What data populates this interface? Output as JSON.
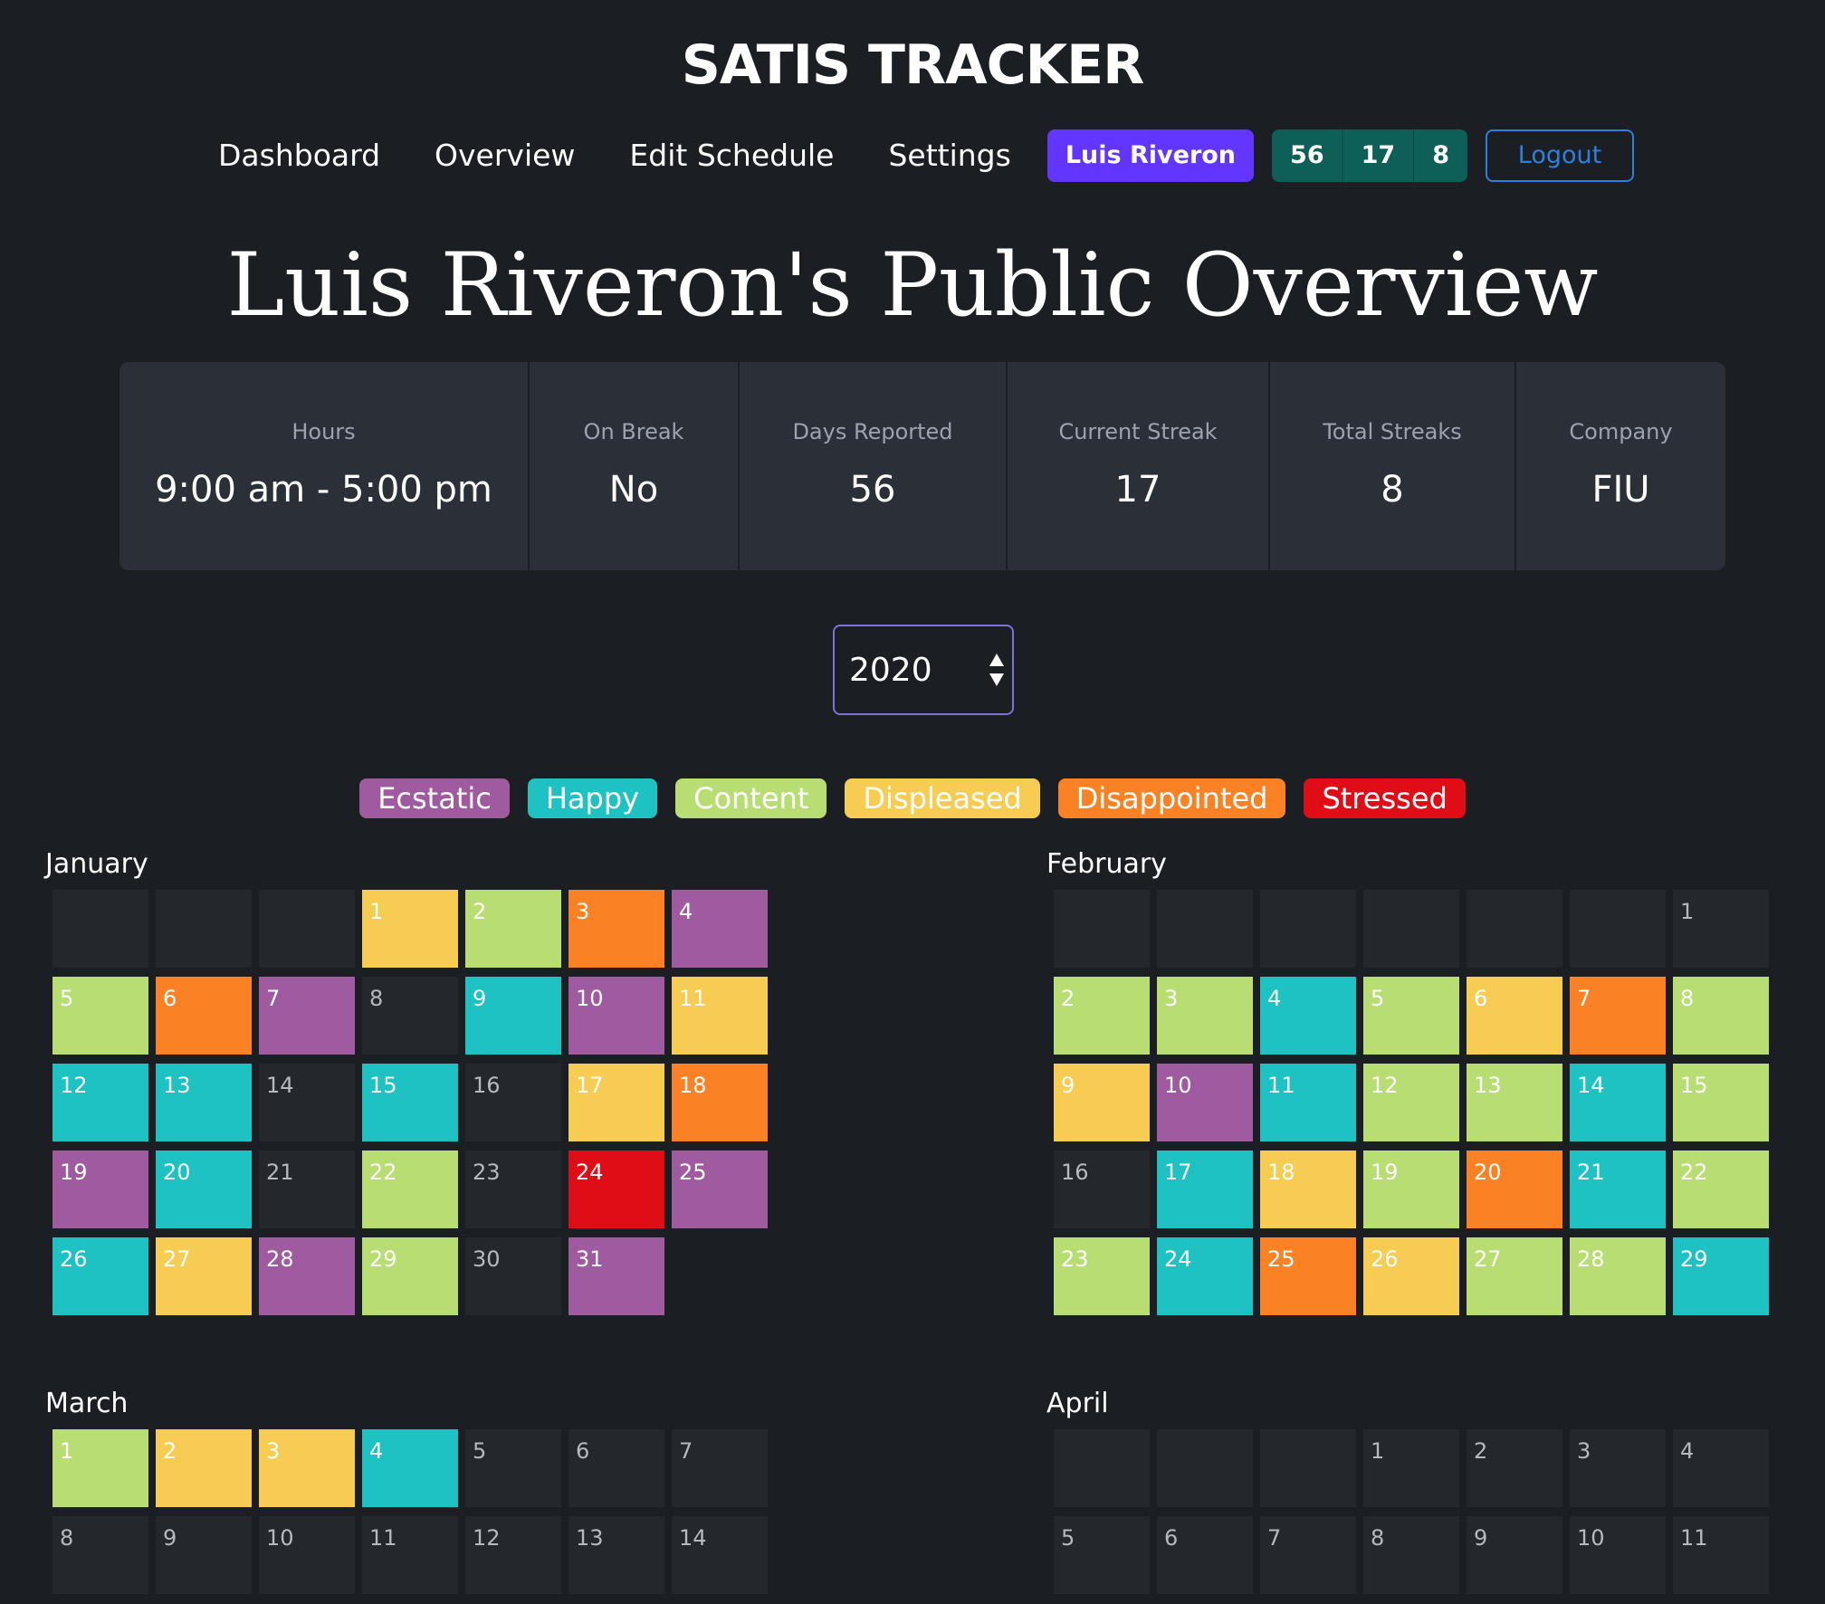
{
  "header": {
    "brand": "SATIS TRACKER"
  },
  "nav": {
    "links": [
      "Dashboard",
      "Overview",
      "Edit Schedule",
      "Settings"
    ],
    "user": "Luis Riveron",
    "counters": [
      "56",
      "17",
      "8"
    ],
    "logout": "Logout"
  },
  "page": {
    "title": "Luis Riveron's Public Overview"
  },
  "stats": [
    {
      "label": "Hours",
      "value": "9:00 am - 5:00 pm"
    },
    {
      "label": "On Break",
      "value": "No"
    },
    {
      "label": "Days Reported",
      "value": "56"
    },
    {
      "label": "Current Streak",
      "value": "17"
    },
    {
      "label": "Total Streaks",
      "value": "8"
    },
    {
      "label": "Company",
      "value": "FIU"
    }
  ],
  "year_select": {
    "value": "2020"
  },
  "moods": {
    "ecstatic": {
      "label": "Ecstatic",
      "color": "#a05a9f"
    },
    "happy": {
      "label": "Happy",
      "color": "#1fc2c2"
    },
    "content": {
      "label": "Content",
      "color": "#b8dd73"
    },
    "displeased": {
      "label": "Displeased",
      "color": "#f6cc52"
    },
    "disappointed": {
      "label": "Disappointed",
      "color": "#fb8224"
    },
    "stressed": {
      "label": "Stressed",
      "color": "#e00d17"
    }
  },
  "legend": [
    "ecstatic",
    "happy",
    "content",
    "displeased",
    "disappointed",
    "stressed"
  ],
  "months": [
    {
      "name": "January",
      "offset": 3,
      "days": 31,
      "moods": [
        "displeased",
        "content",
        "disappointed",
        "ecstatic",
        "content",
        "disappointed",
        "ecstatic",
        null,
        "happy",
        "ecstatic",
        "displeased",
        "happy",
        "happy",
        null,
        "happy",
        null,
        "displeased",
        "disappointed",
        "ecstatic",
        "happy",
        null,
        "content",
        null,
        "stressed",
        "ecstatic",
        "happy",
        "displeased",
        "ecstatic",
        "content",
        null,
        "ecstatic"
      ]
    },
    {
      "name": "February",
      "offset": 6,
      "days": 29,
      "moods": [
        null,
        "content",
        "content",
        "happy",
        "content",
        "displeased",
        "disappointed",
        "content",
        "displeased",
        "ecstatic",
        "happy",
        "content",
        "content",
        "happy",
        "content",
        null,
        "happy",
        "displeased",
        "content",
        "disappointed",
        "happy",
        "content",
        "content",
        "happy",
        "disappointed",
        "displeased",
        "content",
        "content",
        "happy"
      ]
    },
    {
      "name": "March",
      "offset": 0,
      "days": 14,
      "moods": [
        "content",
        "displeased",
        "displeased",
        "happy",
        null,
        null,
        null,
        null,
        null,
        null,
        null,
        null,
        null,
        null
      ]
    },
    {
      "name": "April",
      "offset": 3,
      "days": 11,
      "moods": [
        null,
        null,
        null,
        null,
        null,
        null,
        null,
        null,
        null,
        null,
        null
      ]
    }
  ]
}
